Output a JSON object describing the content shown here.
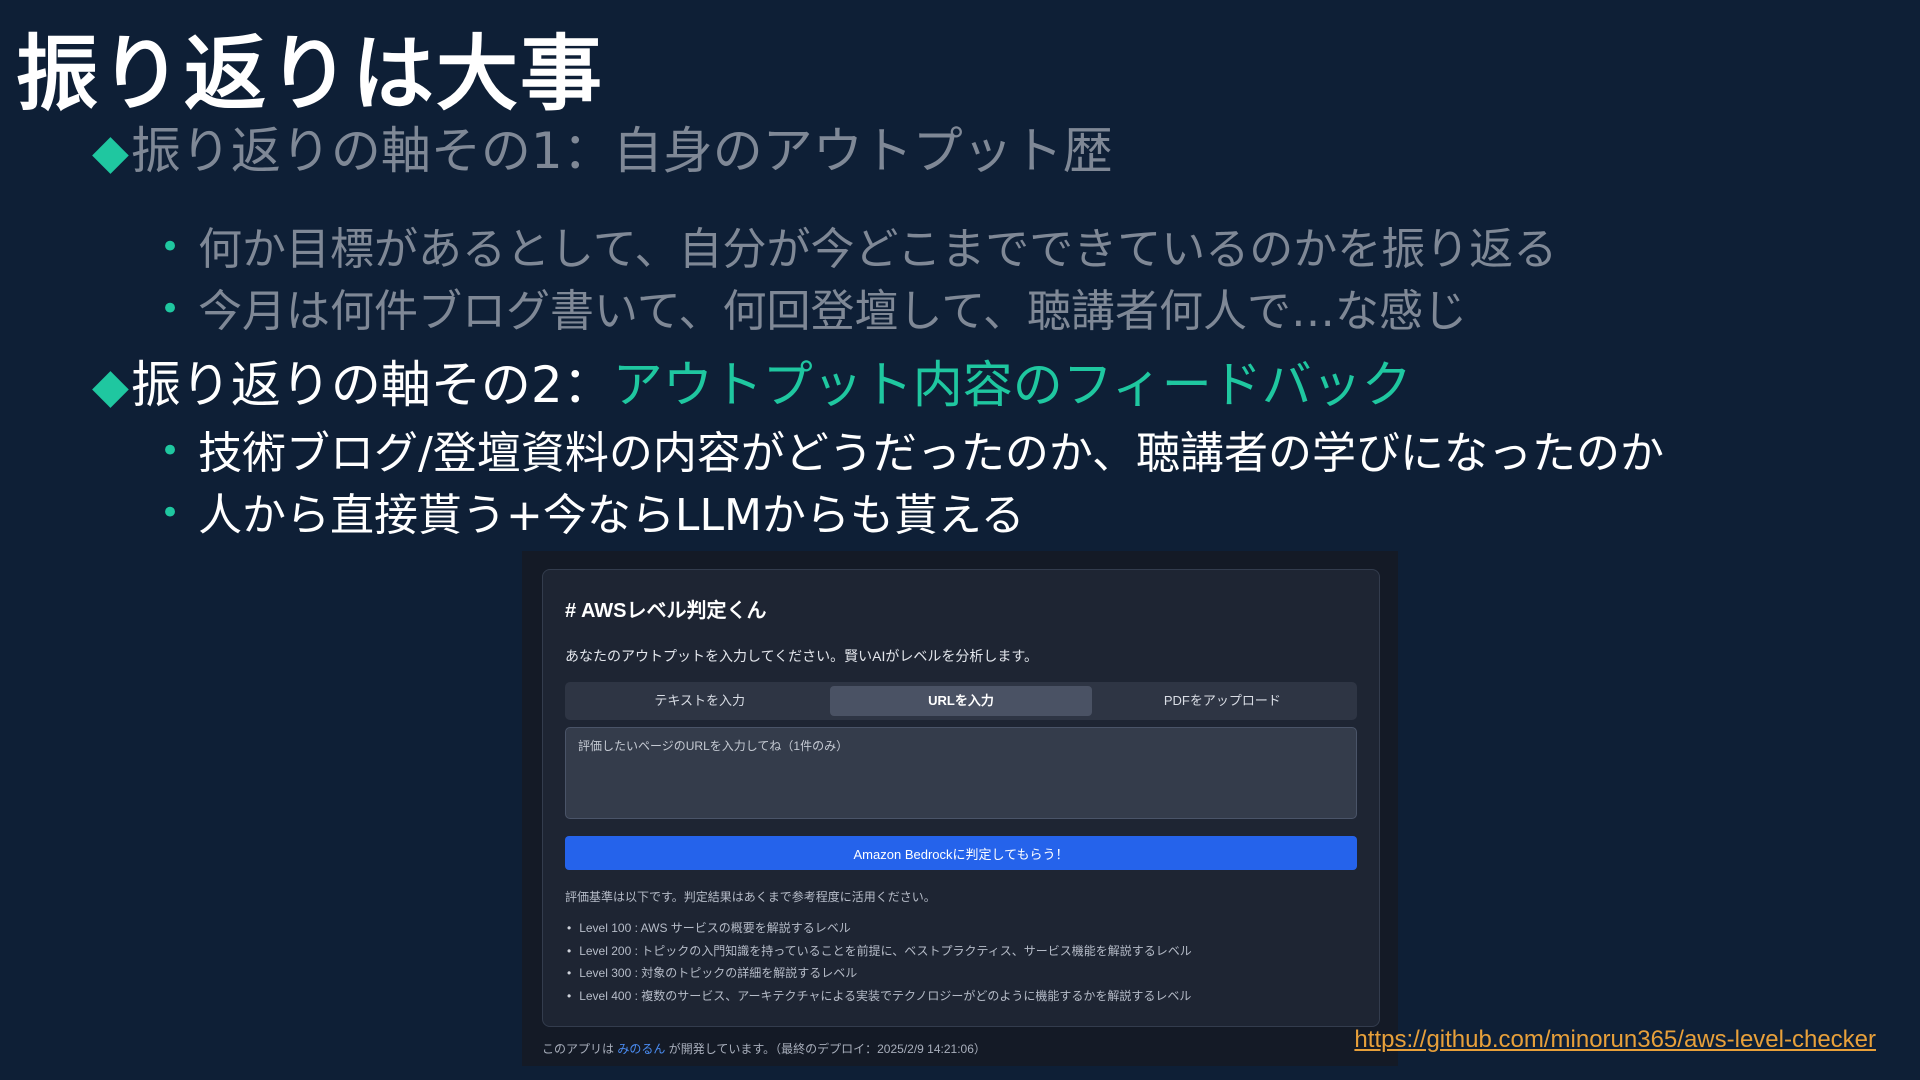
{
  "slide": {
    "title": "振り返りは大事",
    "points": [
      {
        "marker": "◆",
        "text": "振り返りの軸その1：自身のアウトプット歴",
        "highlight": "",
        "subpoints": [
          "何か目標があるとして、自分が今どこまでできているのかを振り返る",
          "今月は何件ブログ書いて、何回登壇して、聴講者何人で…な感じ"
        ]
      },
      {
        "marker": "◆",
        "text": "振り返りの軸その2：",
        "highlight": "アウトプット内容のフィードバック",
        "subpoints": [
          "技術ブログ/登壇資料の内容がどうだったのか、聴講者の学びになったのか",
          "人から直接貰う+今ならLLMからも貰える"
        ]
      }
    ],
    "bullet_dot": "•",
    "repo_link": "https://github.com/minorun365/aws-level-checker"
  },
  "app": {
    "title": "# AWSレベル判定くん",
    "description": "あなたのアウトプットを入力してください。賢いAIがレベルを分析します。",
    "tabs": [
      {
        "label": "テキストを入力",
        "active": false
      },
      {
        "label": "URLを入力",
        "active": true
      },
      {
        "label": "PDFをアップロード",
        "active": false
      }
    ],
    "url_placeholder": "評価したいページのURLを入力してね（1件のみ）",
    "submit_label": "Amazon Bedrockに判定してもらう！",
    "criteria_intro": "評価基準は以下です。判定結果はあくまで参考程度に活用ください。",
    "criteria": [
      "Level 100 : AWS サービスの概要を解説するレベル",
      "Level 200 : トピックの入門知識を持っていることを前提に、ベストプラクティス、サービス機能を解説するレベル",
      "Level 300 : 対象のトピックの詳細を解説するレベル",
      "Level 400 : 複数のサービス、アーキテクチャによる実装でテクノロジーがどのように機能するかを解説するレベル"
    ],
    "footer_prefix": "このアプリは ",
    "footer_author": "みのるん",
    "footer_suffix": " が開発しています。（最終のデプロイ：2025/2/9 14:21:06）"
  },
  "colors": {
    "background": "#0e1f36",
    "accent": "#1fc7a0",
    "dim_text": "#7f8896",
    "button_blue": "#2563eb",
    "link_orange": "#e8a03a"
  }
}
